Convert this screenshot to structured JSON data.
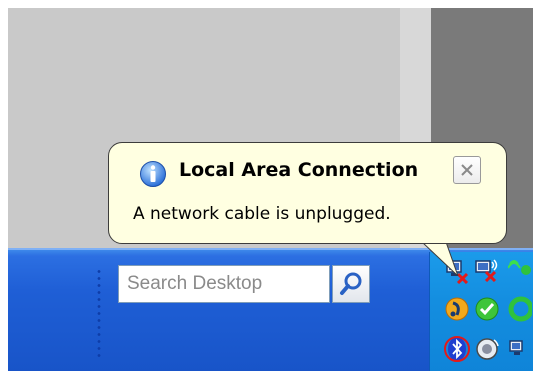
{
  "taskbar": {
    "search": {
      "placeholder": "Search Desktop"
    }
  },
  "balloon": {
    "title": "Local Area Connection",
    "message": "A network cable is unplugged."
  },
  "tray": {
    "icons": [
      "network-disconnected-icon",
      "wireless-disconnected-icon",
      "wireless-signal-icon",
      "security-warning-icon",
      "status-ok-icon",
      "app-icon",
      "bluetooth-icon",
      "volume-icon",
      "network-icon"
    ]
  },
  "colors": {
    "taskbar_blue": "#1f5fd6",
    "tray_blue": "#148ee0",
    "balloon_bg": "#ffffe1"
  }
}
